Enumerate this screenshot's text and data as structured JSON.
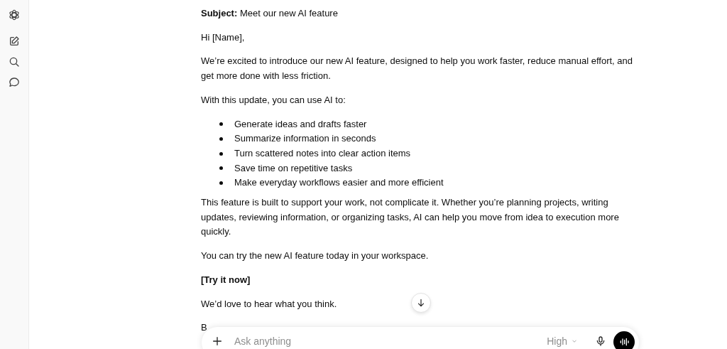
{
  "message": {
    "blocks": [
      {
        "kind": "paragraph",
        "text": "**Subject:** Meet our new AI feature"
      },
      {
        "kind": "paragraph",
        "text": "Hi [Name],"
      },
      {
        "kind": "paragraph",
        "text": "We’re excited to introduce our new AI feature, designed to help you work faster, reduce manual effort, and get more done with less friction."
      },
      {
        "kind": "paragraph",
        "text": "With this update, you can use AI to:"
      },
      {
        "kind": "list",
        "items": [
          "Generate ideas and drafts faster",
          "Summarize information in seconds",
          "Turn scattered notes into clear action items",
          "Save time on repetitive tasks",
          "Make everyday workflows easier and more efficient"
        ]
      },
      {
        "kind": "paragraph",
        "text": "This feature is built to support your work, not complicate it. Whether you’re planning projects, writing updates, reviewing information, or organizing tasks, AI can help you move from idea to execution more quickly."
      },
      {
        "kind": "paragraph",
        "text": "You can try the new AI feature today in your workspace."
      },
      {
        "kind": "bold",
        "text": "[Try it now]"
      },
      {
        "kind": "paragraph",
        "text": "We’d love to hear what you think."
      },
      {
        "kind": "paragraph",
        "text": "B"
      }
    ]
  },
  "composer": {
    "placeholder": "Ask anything",
    "model": "High"
  }
}
